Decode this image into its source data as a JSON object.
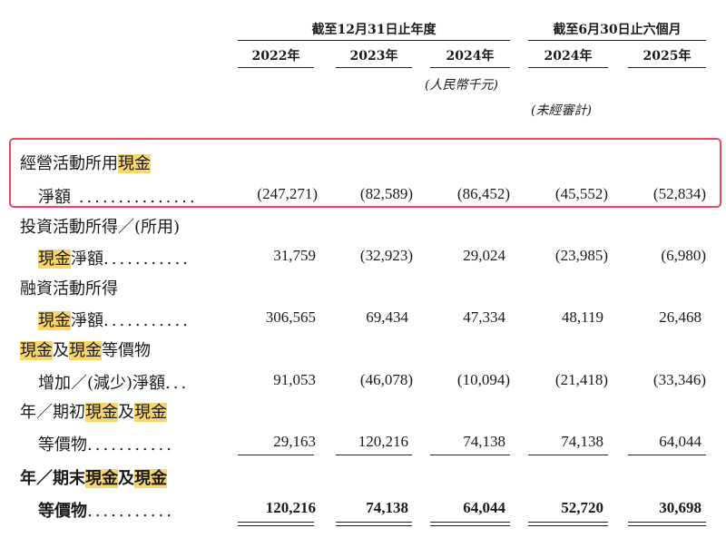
{
  "header": {
    "group1": "截至12月31日止年度",
    "group2": "截至6月30日止六個月",
    "years": [
      "2022年",
      "2023年",
      "2024年",
      "2024年",
      "2025年"
    ],
    "unit_note": "(人民幣千元)",
    "unaudited_note": "(未經審計)"
  },
  "rows": [
    {
      "line1": [
        "經營活動所用",
        "現金"
      ],
      "line2": "淨額",
      "dots": " ...............",
      "values": [
        "(247,271)",
        "(82,589)",
        "(86,452)",
        "(45,552)",
        "(52,834)"
      ]
    },
    {
      "line1": "投資活動所得／(所用)",
      "line2": [
        "現金",
        "淨額"
      ],
      "dots": "...........",
      "values": [
        "31,759",
        "(32,923)",
        "29,024",
        "(23,985)",
        "(6,980)"
      ]
    },
    {
      "line1": "融資活動所得",
      "line2": [
        "現金",
        "淨額"
      ],
      "dots": "...........",
      "values": [
        "306,565",
        "69,434",
        "47,334",
        "48,119",
        "26,468"
      ]
    },
    {
      "line1": [
        "現金",
        "及",
        "現金",
        "等價物"
      ],
      "line2": "增加／(減少)淨額",
      "dots": "...",
      "values": [
        "91,053",
        "(46,078)",
        "(10,094)",
        "(21,418)",
        "(33,346)"
      ]
    },
    {
      "line1": [
        "年／期初",
        "現金",
        "及",
        "現金"
      ],
      "line2": "等價物",
      "dots": "...........",
      "values": [
        "29,163",
        "120,216",
        "74,138",
        "74,138",
        "64,044"
      ]
    },
    {
      "line1": [
        "年／期末",
        "現金",
        "及",
        "現金"
      ],
      "line2": "等價物",
      "dots": "...........",
      "values": [
        "120,216",
        "74,138",
        "64,044",
        "52,720",
        "30,698"
      ]
    }
  ]
}
